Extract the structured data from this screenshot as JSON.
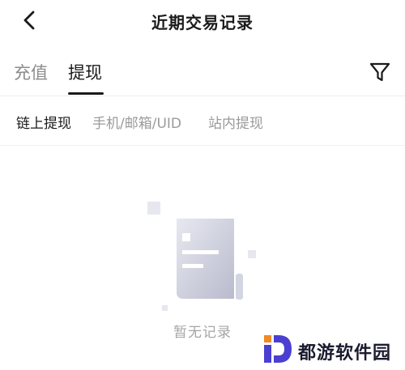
{
  "header": {
    "title": "近期交易记录",
    "back_icon": "chevron-left-icon"
  },
  "tabs": {
    "items": [
      {
        "label": "充值",
        "active": false
      },
      {
        "label": "提现",
        "active": true
      }
    ],
    "filter_icon": "filter-funnel-icon"
  },
  "subtabs": {
    "items": [
      {
        "label": "链上提现",
        "active": true
      },
      {
        "label": "手机/邮箱/UID",
        "active": false
      },
      {
        "label": "站内提现",
        "active": false
      }
    ]
  },
  "empty_state": {
    "message": "暂无记录",
    "icon": "document-icon"
  },
  "watermark": {
    "text": "都游软件园",
    "logo_icon": "d-logo-icon"
  },
  "colors": {
    "text_primary": "#1a1a1a",
    "text_secondary": "#8c8c8c",
    "empty_text": "#a6a6a6",
    "illustration": "#c9cbdc",
    "watermark_orange": "#f08a24",
    "watermark_purple": "#4b3fd1"
  }
}
